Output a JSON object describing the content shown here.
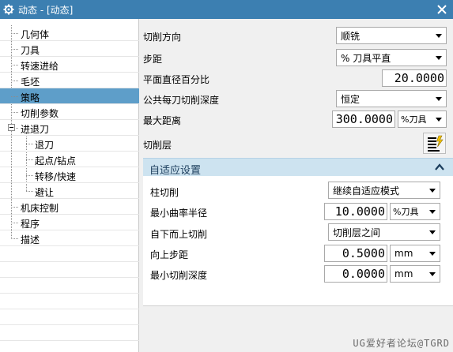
{
  "window": {
    "title": "动态 - [动态]"
  },
  "tree": {
    "items": [
      {
        "label": "几何体"
      },
      {
        "label": "刀具"
      },
      {
        "label": "转速进给"
      },
      {
        "label": "毛坯"
      },
      {
        "label": "策略",
        "selected": true
      },
      {
        "label": "切削参数"
      },
      {
        "label": "进退刀",
        "expanded": true
      },
      {
        "label": "退刀"
      },
      {
        "label": "起点/钻点"
      },
      {
        "label": "转移/快速"
      },
      {
        "label": "避让"
      },
      {
        "label": "机床控制"
      },
      {
        "label": "程序"
      },
      {
        "label": "描述"
      }
    ]
  },
  "form": {
    "cut_direction": {
      "label": "切削方向",
      "value": "顺铣"
    },
    "stepover": {
      "label": "步距",
      "value": "% 刀具平直"
    },
    "flat_diameter_percent": {
      "label": "平面直径百分比",
      "value": "20.0000"
    },
    "common_depth": {
      "label": "公共每刀切削深度",
      "value": "恒定"
    },
    "max_distance": {
      "label": "最大距离",
      "value": "300.0000",
      "unit": "%刀具"
    },
    "cut_levels": {
      "label": "切削层"
    }
  },
  "adaptive": {
    "title": "自适应设置",
    "column_cut": {
      "label": "柱切削",
      "value": "继续自适应模式"
    },
    "min_curvature_radius": {
      "label": "最小曲率半径",
      "value": "10.0000",
      "unit": "%刀具"
    },
    "bottom_up": {
      "label": "自下而上切削",
      "value": "切削层之间"
    },
    "upward_step": {
      "label": "向上步距",
      "value": "0.5000",
      "unit": "mm"
    },
    "min_cut_depth": {
      "label": "最小切削深度",
      "value": "0.0000",
      "unit": "mm"
    }
  },
  "footer": {
    "watermark": "UG爱好者论坛@TGRD"
  },
  "colors": {
    "titlebar": "#3c7fb1",
    "selection": "#5e9ec9",
    "group_header": "#cde3f0"
  }
}
